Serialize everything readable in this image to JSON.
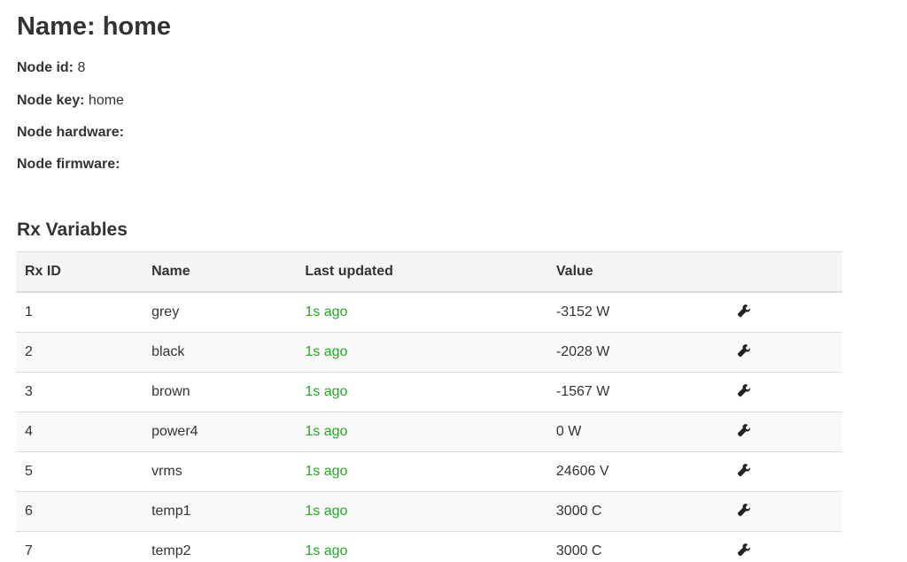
{
  "node": {
    "name_label": "Name: home",
    "id_label": "Node id:",
    "id_value": "8",
    "key_label": "Node key:",
    "key_value": "home",
    "hardware_label": "Node hardware:",
    "hardware_value": "",
    "firmware_label": "Node firmware:",
    "firmware_value": ""
  },
  "rx": {
    "title": "Rx Variables",
    "columns": [
      "Rx ID",
      "Name",
      "Last updated",
      "Value",
      ""
    ],
    "rows": [
      {
        "id": "1",
        "name": "grey",
        "updated": "1s ago",
        "value": "-3152 W",
        "action_icon": "wrench-icon"
      },
      {
        "id": "2",
        "name": "black",
        "updated": "1s ago",
        "value": "-2028 W",
        "action_icon": "wrench-icon"
      },
      {
        "id": "3",
        "name": "brown",
        "updated": "1s ago",
        "value": "-1567 W",
        "action_icon": "wrench-icon"
      },
      {
        "id": "4",
        "name": "power4",
        "updated": "1s ago",
        "value": "0 W",
        "action_icon": "wrench-icon"
      },
      {
        "id": "5",
        "name": "vrms",
        "updated": "1s ago",
        "value": "24606 V",
        "action_icon": "wrench-icon"
      },
      {
        "id": "6",
        "name": "temp1",
        "updated": "1s ago",
        "value": "3000 C",
        "action_icon": "wrench-icon"
      },
      {
        "id": "7",
        "name": "temp2",
        "updated": "1s ago",
        "value": "3000 C",
        "action_icon": "wrench-icon"
      }
    ]
  },
  "colors": {
    "updated_text": "#22aa22",
    "header_bg": "#f5f5f5",
    "stripe_bg": "#f9f9f9"
  }
}
